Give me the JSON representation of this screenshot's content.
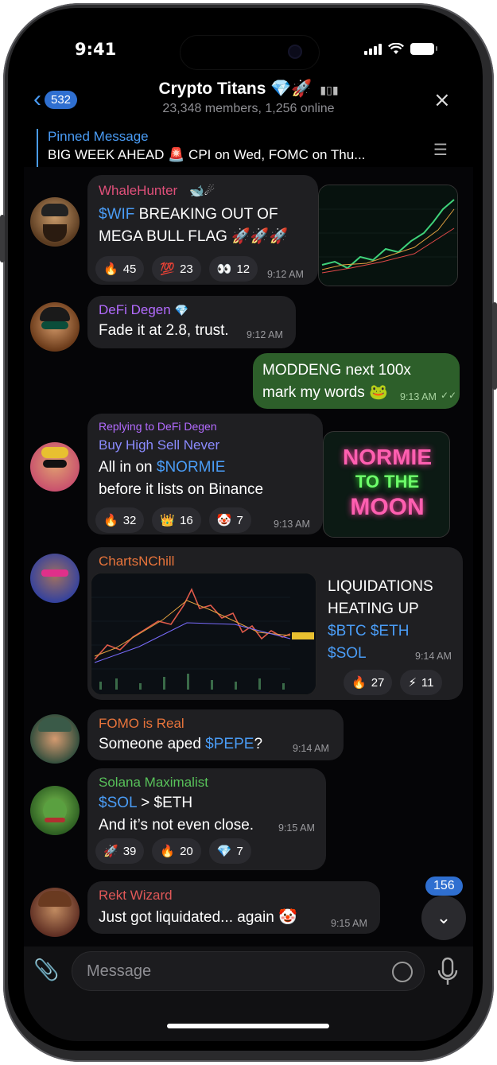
{
  "status": {
    "time": "9:41"
  },
  "header": {
    "back_count": "532",
    "title": "Crypto Titans 💎🚀",
    "subtitle": "23,348 members, 1,256 online"
  },
  "pinned": {
    "label": "Pinned Message",
    "text": "BIG WEEK AHEAD 🚨 CPI on Wed, FOMC on Thu..."
  },
  "messages": [
    {
      "name": "WhaleHunter",
      "name_suffix": "🐋☄",
      "tag": "$WIF",
      "line1_rest": " BREAKING OUT OF",
      "line2": "MEGA BULL FLAG 🚀🚀🚀",
      "time": "9:12 AM",
      "reactions": [
        {
          "emoji": "🔥",
          "count": "45"
        },
        {
          "emoji": "💯",
          "count": "23"
        },
        {
          "emoji": "👀",
          "count": "12"
        }
      ]
    },
    {
      "name": "DeFi Degen",
      "badge": "💎",
      "text": "Fade it at 2.8, trust.",
      "time": "9:12 AM"
    },
    {
      "line1": "MODDENG next 100x",
      "line2": "mark my words 🐸",
      "time": "9:13 AM"
    },
    {
      "reply_to": "Replying to DeFi Degen",
      "name": "Buy High Sell Never",
      "line1_pre": "All in on ",
      "tag": "$NORMIE",
      "line2": "before it lists on Binance",
      "time": "9:13 AM",
      "reactions": [
        {
          "emoji": "🔥",
          "count": "32"
        },
        {
          "emoji": "👑",
          "count": "16"
        },
        {
          "emoji": "🤡",
          "count": "7"
        }
      ],
      "image_text": [
        "NORMIE",
        "TO THE",
        "MOON"
      ]
    },
    {
      "name": "ChartsNChill",
      "line1": "LIQUIDATIONS",
      "line2": "HEATING UP",
      "tag1": "$BTC",
      "tag2": "$ETH",
      "tag3": "$SOL",
      "time": "9:14 AM",
      "reactions": [
        {
          "emoji": "🔥",
          "count": "27"
        },
        {
          "emoji": "⚡",
          "count": "11"
        }
      ]
    },
    {
      "name": "FOMO is Real",
      "pre": "Someone aped ",
      "tag": "$PEPE",
      "post": "?",
      "time": "9:14 AM"
    },
    {
      "name": "Solana Maximalist",
      "tag": "$SOL",
      "line1_rest": " > $ETH",
      "line2": "And it’s not even close.",
      "time": "9:15 AM",
      "reactions": [
        {
          "emoji": "🚀",
          "count": "39"
        },
        {
          "emoji": "🔥",
          "count": "20"
        },
        {
          "emoji": "💎",
          "count": "7"
        }
      ]
    },
    {
      "name": "Rekt Wizard",
      "text": "Just got liquidated... again 🤡",
      "time": "9:15 AM"
    }
  ],
  "scroll_badge": "156",
  "composer": {
    "placeholder": "Message"
  },
  "colors": {
    "accent": "#4a9cf5",
    "outgoing": "#2d5f2a",
    "bubble": "#1f1f22",
    "names": [
      "#e0507a",
      "#b36bff",
      "#8b8bff",
      "#e8743b",
      "#e8743b",
      "#58c25a",
      "#e05858"
    ]
  }
}
